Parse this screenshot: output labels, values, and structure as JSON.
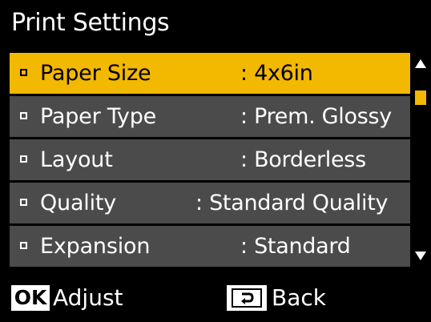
{
  "header": {
    "title": "Print Settings"
  },
  "settings": {
    "items": [
      {
        "label": "Paper Size",
        "value": ": 4x6in",
        "selected": true
      },
      {
        "label": "Paper Type",
        "value": ": Prem. Glossy",
        "selected": false
      },
      {
        "label": "Layout",
        "value": ": Borderless",
        "selected": false
      },
      {
        "label": "Quality",
        "value": ": Standard Quality",
        "selected": false
      },
      {
        "label": "Expansion",
        "value": ": Standard",
        "selected": false
      }
    ]
  },
  "footer": {
    "ok_key": "OK",
    "adjust_label": "Adjust",
    "back_icon": "back-arrow-icon",
    "back_label": "Back"
  },
  "colors": {
    "background": "#000000",
    "row": "#4b4b4b",
    "highlight": "#f3b800",
    "text": "#ffffff"
  }
}
